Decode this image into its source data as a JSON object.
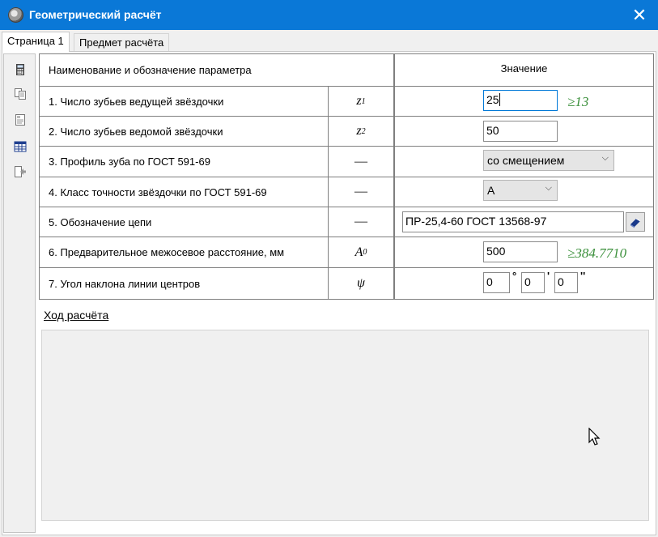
{
  "window": {
    "title": "Геометрический расчёт",
    "close_glyph": "✕",
    "titlebar_color": "#0a78d7"
  },
  "tabs": [
    {
      "label": "Страница 1",
      "selected": true
    },
    {
      "label": "Предмет расчёта",
      "selected": false
    }
  ],
  "toolbar": {
    "icons": [
      "calculator-icon",
      "copy-icon",
      "report-icon",
      "table-icon",
      "export-icon"
    ]
  },
  "table": {
    "headers": {
      "param": "Наименование и обозначение параметра",
      "value": "Значение"
    },
    "rows": [
      {
        "label": "1. Число зубьев ведущей звёздочки",
        "sym": "z",
        "sub": "1",
        "value": "25",
        "hint": "≥13"
      },
      {
        "label": "2. Число зубьев ведомой звёздочки",
        "sym": "z",
        "sub": "2",
        "value": "50"
      },
      {
        "label": "3. Профиль зуба по ГОСТ 591-69",
        "sym": "—",
        "sub": "",
        "value": "со смещением"
      },
      {
        "label": "4. Класс точности звёздочки по ГОСТ 591-69",
        "sym": "—",
        "sub": "",
        "value": "A"
      },
      {
        "label": "5. Обозначение цепи",
        "sym": "—",
        "sub": "",
        "value": "ПР-25,4-60 ГОСТ 13568-97"
      },
      {
        "label": "6. Предварительное межосевое расстояние, мм",
        "sym": "A",
        "sub": "0",
        "value": "500",
        "hint": "≥384.7710"
      },
      {
        "label": "7. Угол наклона линии центров",
        "sym": "ψ",
        "sub": "",
        "deg": "0",
        "min": "0",
        "sec": "0",
        "deg_mark": "°",
        "min_mark": "'",
        "sec_mark": "''"
      }
    ]
  },
  "progress": {
    "label": "Ход расчёта"
  },
  "colors": {
    "hint": "#3a8f3a",
    "grid_line": "#7f7f7f"
  }
}
